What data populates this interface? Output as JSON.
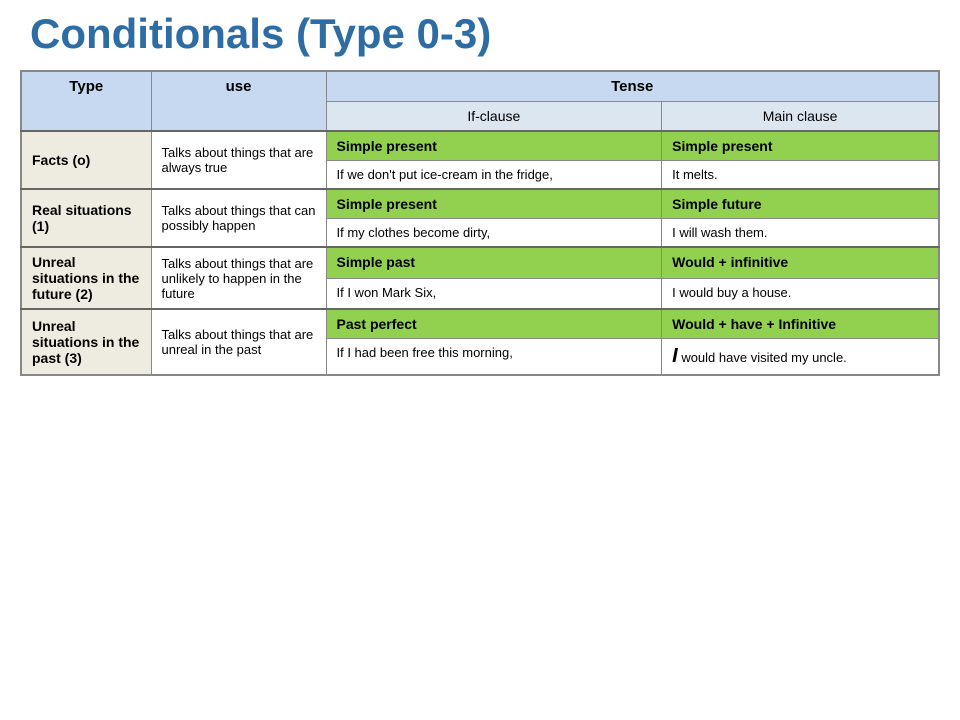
{
  "title": "Conditionals (Type 0-3)",
  "headers": {
    "type": "Type",
    "use": "use",
    "tense": "Tense",
    "if_clause": "If-clause",
    "main_clause": "Main clause"
  },
  "rows": [
    {
      "type": "Facts (o)",
      "use": "Talks about things that are always true",
      "tense_if": "Simple present",
      "tense_main": "Simple present",
      "example_if": "If we don't put ice-cream in the fridge,",
      "example_main": "It melts."
    },
    {
      "type": "Real situations (1)",
      "use": "Talks about things that can possibly happen",
      "tense_if": "Simple present",
      "tense_main": "Simple future",
      "example_if": "If my clothes become dirty,",
      "example_main": "I will wash them."
    },
    {
      "type": "Unreal situations in the future (2)",
      "use": "Talks about things that are unlikely to happen in the future",
      "tense_if": "Simple past",
      "tense_main": "Would + infinitive",
      "example_if": "If I won Mark Six,",
      "example_main": "I would buy a house."
    },
    {
      "type": "Unreal situations in the past (3)",
      "use": "Talks about things that are unreal in the past",
      "tense_if": "Past perfect",
      "tense_main": "Would + have + Infinitive",
      "example_if": "If I had been free this morning,",
      "example_main": "I  would have visited my uncle."
    }
  ]
}
